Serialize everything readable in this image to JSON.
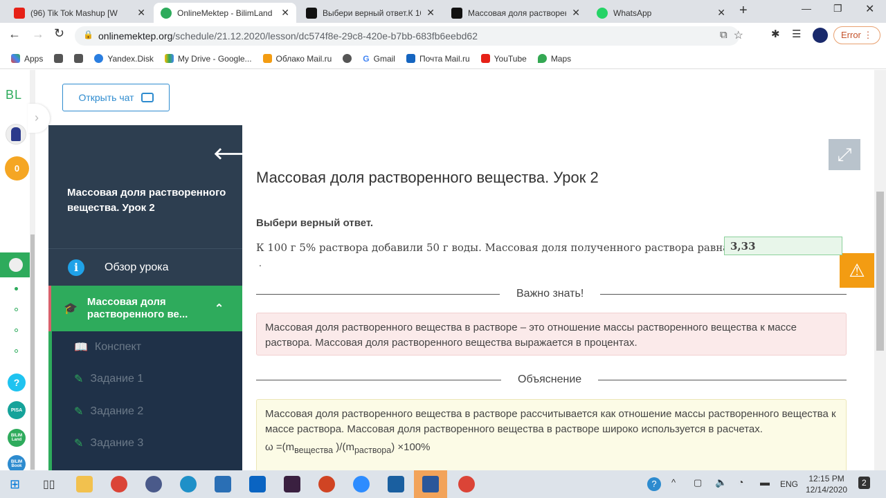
{
  "browser": {
    "tabs": [
      {
        "title": "(96) Tik Tok Mashup [W",
        "color": "#e62117"
      },
      {
        "title": "OnlineMektep - BilimLand",
        "color": "#2eab5c"
      },
      {
        "title": "Выбери верный ответ.К 10",
        "color": "#111"
      },
      {
        "title": "Массовая доля растворен",
        "color": "#111"
      },
      {
        "title": "WhatsApp",
        "color": "#25d366"
      }
    ],
    "url_host": "onlinemektep.org",
    "url_path": "/schedule/21.12.2020/lesson/dc574f8e-29c8-420e-b7bb-683fb6eebd62",
    "error_label": "Error",
    "bookmarks": [
      "Apps",
      "Yandex.Disk",
      "My Drive - Google...",
      "Облако Mail.ru",
      "Gmail",
      "Почта Mail.ru",
      "YouTube",
      "Maps"
    ]
  },
  "rail": {
    "logo": "BL",
    "score": "0",
    "help": "?",
    "pisa": "PISA",
    "bilimland": "BILIM Land",
    "bilimbook": "BILIM Book"
  },
  "chat_button": "Открыть чат",
  "sidebar": {
    "title": "Массовая доля растворенного вещества. Урок 2",
    "overview": "Обзор урока",
    "section": "Массовая доля растворенного ве...",
    "items": [
      "Конспект",
      "Задание 1",
      "Задание 2",
      "Задание 3"
    ]
  },
  "content": {
    "title": "Массовая доля растворенного вещества. Урок 2",
    "instruction": "Выбери верный ответ.",
    "question": "К 100 г 5% раствора добавили 50 г воды. Массовая доля полученного раствора равна",
    "answer": "3,33",
    "answer_suffix": ".",
    "important_label": "Важно знать!",
    "important_text": "Массовая доля растворенного вещества в растворе – это отношение массы растворенного вещества к массе раствора. Массовая доля растворенного вещества выражается в процентах.",
    "explain_label": "Объяснение",
    "explain_text": "Массовая доля растворенного вещества в растворе рассчитывается как отношение массы растворенного вещества к массе раствора. Массовая доля растворенного вещества в растворе широко используется в расчетах.",
    "formula": {
      "a": "ω =(m",
      "s1": "вещества",
      "b": " )/(m",
      "s2": "раствора",
      "c": ") ×100%"
    }
  },
  "taskbar": {
    "lang": "ENG",
    "time": "12:15 PM",
    "date": "12/14/2020",
    "notif": "2"
  }
}
